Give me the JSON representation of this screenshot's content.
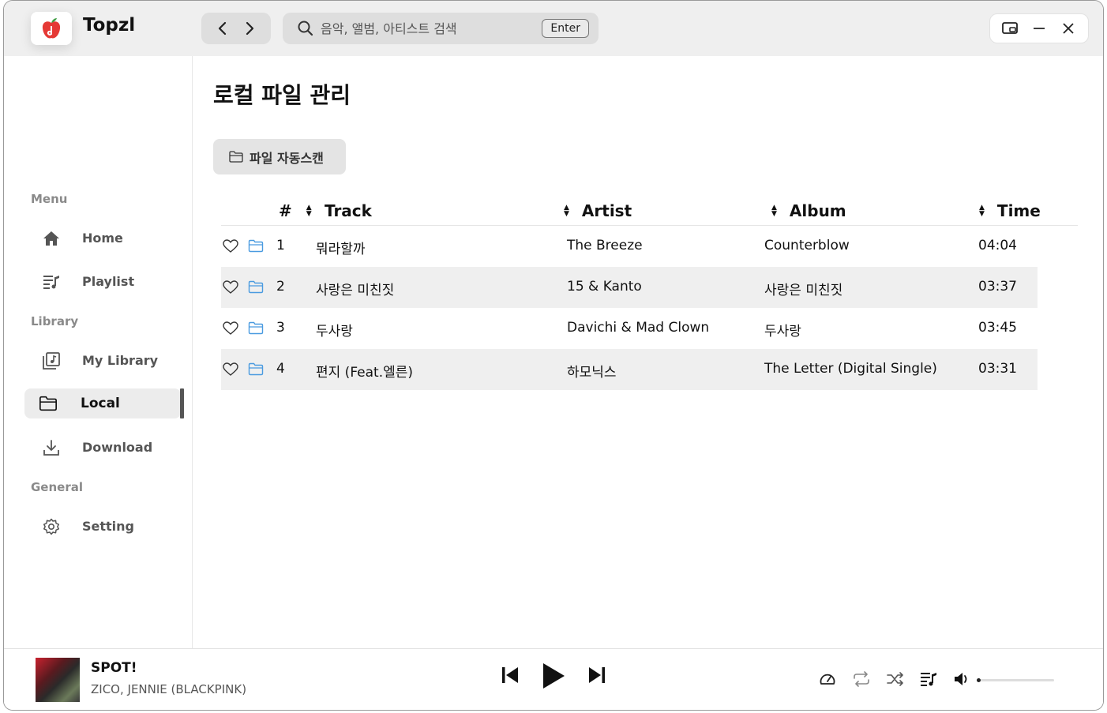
{
  "app": {
    "name": "Topzl"
  },
  "search": {
    "placeholder": "음악, 앨범, 아티스트 검색",
    "enter_label": "Enter"
  },
  "sidebar": {
    "sections": [
      {
        "label": "Menu",
        "items": [
          {
            "label": "Home",
            "icon": "home-icon"
          },
          {
            "label": "Playlist",
            "icon": "playlist-icon"
          }
        ]
      },
      {
        "label": "Library",
        "items": [
          {
            "label": "My Library",
            "icon": "library-icon"
          },
          {
            "label": "Local",
            "icon": "folder-icon",
            "active": true
          },
          {
            "label": "Download",
            "icon": "download-icon"
          }
        ]
      },
      {
        "label": "General",
        "items": [
          {
            "label": "Setting",
            "icon": "gear-icon"
          }
        ]
      }
    ]
  },
  "page": {
    "title": "로컬 파일 관리",
    "scan_button": "파일 자동스캔"
  },
  "table": {
    "headers": {
      "num": "#",
      "track": "Track",
      "artist": "Artist",
      "album": "Album",
      "time": "Time"
    },
    "rows": [
      {
        "num": "1",
        "track": "뭐라할까",
        "artist": "The Breeze",
        "album": "Counterblow",
        "time": "04:04"
      },
      {
        "num": "2",
        "track": "사랑은 미친짓",
        "artist": "15 & Kanto",
        "album": "사랑은 미친짓",
        "time": "03:37"
      },
      {
        "num": "3",
        "track": "두사랑",
        "artist": "Davichi & Mad Clown",
        "album": "두사랑",
        "time": "03:45"
      },
      {
        "num": "4",
        "track": "편지 (Feat.엘른)",
        "artist": "하모닉스",
        "album": "The Letter (Digital Single)",
        "time": "03:31"
      }
    ]
  },
  "player": {
    "title": "SPOT!",
    "artist": "ZICO, JENNIE (BLACKPINK)",
    "volume": 0.03,
    "colors": {
      "accent": "#111111",
      "folder_icon": "#4a9be0"
    }
  }
}
